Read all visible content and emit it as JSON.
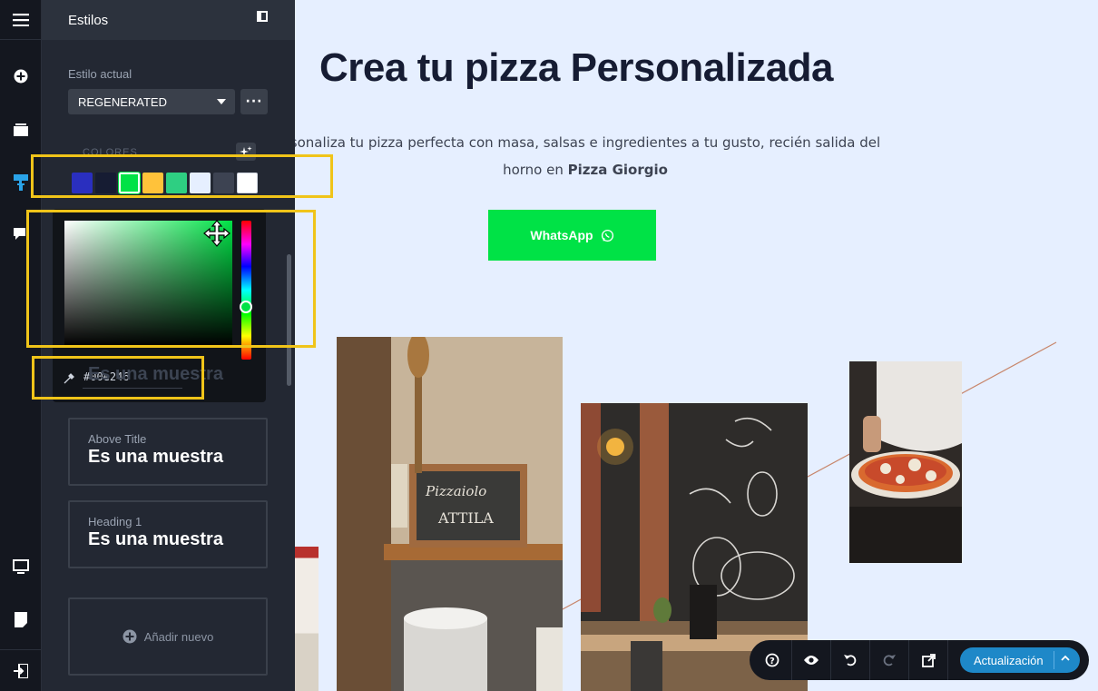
{
  "panel": {
    "title": "Estilos",
    "current_style_label": "Estilo actual",
    "current_style_value": "REGENERATED",
    "more_label": "···",
    "colors_label": "COLORES",
    "palette": [
      "#2a2fbf",
      "#161c33",
      "#00e246",
      "#ffc23a",
      "#2ecf82",
      "#e6efff",
      "#3d4352",
      "#ffffff"
    ],
    "selected_color": "#00e246",
    "hex_value": "#00e246",
    "ghost_sample": "Es una muestra",
    "cards": [
      {
        "label": "Above Title",
        "sample": "Es una muestra"
      },
      {
        "label": "Heading 1",
        "sample": "Es una muestra"
      }
    ],
    "add_new_label": "Añadir nuevo"
  },
  "page": {
    "headline": "Crea tu pizza Personalizada",
    "subtext_line1": "sonaliza tu pizza perfecta con masa, salsas e ingredientes a tu gusto, recién salida del",
    "subtext_line2_start": "horno en ",
    "subtext_brand": "Pizza Giorgio",
    "whatsapp_label": "WhatsApp",
    "accent_color": "#00e246",
    "photos": [
      {
        "icon": "pizzeria-shop-photo",
        "sign_line1": "Pizzaiolo",
        "sign_line2": "ATTILA"
      },
      {
        "icon": "chalkboard-wall-photo"
      },
      {
        "icon": "pizza-chef-photo"
      }
    ]
  },
  "toolbar": {
    "update_label": "Actualización",
    "icons": [
      "help-icon",
      "preview-eye-icon",
      "undo-icon",
      "redo-icon",
      "open-external-icon"
    ]
  }
}
